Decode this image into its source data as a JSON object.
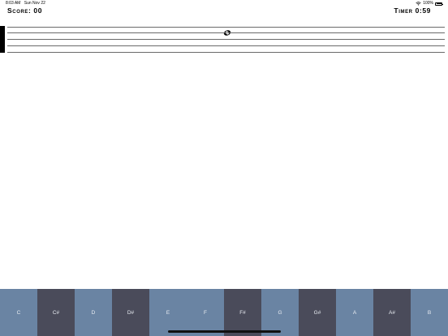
{
  "status_bar": {
    "time": "8:03 AM",
    "date": "Sun Nov 22",
    "battery": "100%",
    "battery_level": 1.0
  },
  "header": {
    "score": "Score: 00",
    "timer": "Timer 0:59"
  },
  "staff": {
    "line_count": 5,
    "note_icon": "whole-note-icon"
  },
  "keyboard": {
    "keys": [
      {
        "label": "C",
        "kind": "natural"
      },
      {
        "label": "C#",
        "kind": "sharp"
      },
      {
        "label": "D",
        "kind": "natural"
      },
      {
        "label": "D#",
        "kind": "sharp"
      },
      {
        "label": "E",
        "kind": "natural"
      },
      {
        "label": "F",
        "kind": "natural"
      },
      {
        "label": "F#",
        "kind": "sharp"
      },
      {
        "label": "G",
        "kind": "natural"
      },
      {
        "label": "G#",
        "kind": "sharp"
      },
      {
        "label": "A",
        "kind": "natural"
      },
      {
        "label": "A#",
        "kind": "sharp"
      },
      {
        "label": "B",
        "kind": "natural"
      }
    ]
  },
  "colors": {
    "natural_key": "#6a84a3",
    "sharp_key": "#4a4b5a",
    "key_text": "#e8ecf2",
    "staff_line": "#6a6a6a"
  }
}
